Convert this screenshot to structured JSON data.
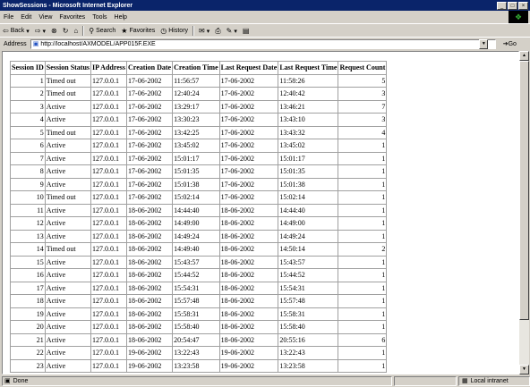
{
  "window": {
    "title": "ShowSessions - Microsoft Internet Explorer",
    "controls": [
      "_",
      "□",
      "×"
    ]
  },
  "menu": [
    "File",
    "Edit",
    "View",
    "Favorites",
    "Tools",
    "Help"
  ],
  "toolbar": {
    "back": "Back",
    "search": "Search",
    "favorites": "Favorites",
    "history": "History"
  },
  "address": {
    "label": "Address",
    "value": "http://localhost/AXMODEL/APP015F.EXE",
    "go": "Go"
  },
  "table": {
    "headers": [
      "Session ID",
      "Session Status",
      "IP Address",
      "Creation Date",
      "Creation Time",
      "Last Request Date",
      "Last Request Time",
      "Request Count"
    ],
    "rows": [
      [
        "1",
        "Timed out",
        "127.0.0.1",
        "17-06-2002",
        "11:56:57",
        "17-06-2002",
        "11:58:26",
        "5"
      ],
      [
        "2",
        "Timed out",
        "127.0.0.1",
        "17-06-2002",
        "12:40:24",
        "17-06-2002",
        "12:40:42",
        "3"
      ],
      [
        "3",
        "Active",
        "127.0.0.1",
        "17-06-2002",
        "13:29:17",
        "17-06-2002",
        "13:46:21",
        "7"
      ],
      [
        "4",
        "Active",
        "127.0.0.1",
        "17-06-2002",
        "13:30:23",
        "17-06-2002",
        "13:43:10",
        "3"
      ],
      [
        "5",
        "Timed out",
        "127.0.0.1",
        "17-06-2002",
        "13:42:25",
        "17-06-2002",
        "13:43:32",
        "4"
      ],
      [
        "6",
        "Active",
        "127.0.0.1",
        "17-06-2002",
        "13:45:02",
        "17-06-2002",
        "13:45:02",
        "1"
      ],
      [
        "7",
        "Active",
        "127.0.0.1",
        "17-06-2002",
        "15:01:17",
        "17-06-2002",
        "15:01:17",
        "1"
      ],
      [
        "8",
        "Active",
        "127.0.0.1",
        "17-06-2002",
        "15:01:35",
        "17-06-2002",
        "15:01:35",
        "1"
      ],
      [
        "9",
        "Active",
        "127.0.0.1",
        "17-06-2002",
        "15:01:38",
        "17-06-2002",
        "15:01:38",
        "1"
      ],
      [
        "10",
        "Timed out",
        "127.0.0.1",
        "17-06-2002",
        "15:02:14",
        "17-06-2002",
        "15:02:14",
        "1"
      ],
      [
        "11",
        "Active",
        "127.0.0.1",
        "18-06-2002",
        "14:44:40",
        "18-06-2002",
        "14:44:40",
        "1"
      ],
      [
        "12",
        "Active",
        "127.0.0.1",
        "18-06-2002",
        "14:49:00",
        "18-06-2002",
        "14:49:00",
        "1"
      ],
      [
        "13",
        "Active",
        "127.0.0.1",
        "18-06-2002",
        "14:49:24",
        "18-06-2002",
        "14:49:24",
        "1"
      ],
      [
        "14",
        "Timed out",
        "127.0.0.1",
        "18-06-2002",
        "14:49:40",
        "18-06-2002",
        "14:50:14",
        "2"
      ],
      [
        "15",
        "Active",
        "127.0.0.1",
        "18-06-2002",
        "15:43:57",
        "18-06-2002",
        "15:43:57",
        "1"
      ],
      [
        "16",
        "Active",
        "127.0.0.1",
        "18-06-2002",
        "15:44:52",
        "18-06-2002",
        "15:44:52",
        "1"
      ],
      [
        "17",
        "Active",
        "127.0.0.1",
        "18-06-2002",
        "15:54:31",
        "18-06-2002",
        "15:54:31",
        "1"
      ],
      [
        "18",
        "Active",
        "127.0.0.1",
        "18-06-2002",
        "15:57:48",
        "18-06-2002",
        "15:57:48",
        "1"
      ],
      [
        "19",
        "Active",
        "127.0.0.1",
        "18-06-2002",
        "15:58:31",
        "18-06-2002",
        "15:58:31",
        "1"
      ],
      [
        "20",
        "Active",
        "127.0.0.1",
        "18-06-2002",
        "15:58:40",
        "18-06-2002",
        "15:58:40",
        "1"
      ],
      [
        "21",
        "Active",
        "127.0.0.1",
        "18-06-2002",
        "20:54:47",
        "18-06-2002",
        "20:55:16",
        "6"
      ],
      [
        "22",
        "Active",
        "127.0.0.1",
        "19-06-2002",
        "13:22:43",
        "19-06-2002",
        "13:22:43",
        "1"
      ],
      [
        "23",
        "Active",
        "127.0.0.1",
        "19-06-2002",
        "13:23:58",
        "19-06-2002",
        "13:23:58",
        "1"
      ]
    ]
  },
  "status": {
    "text": "Done",
    "zone": "Local intranet"
  }
}
